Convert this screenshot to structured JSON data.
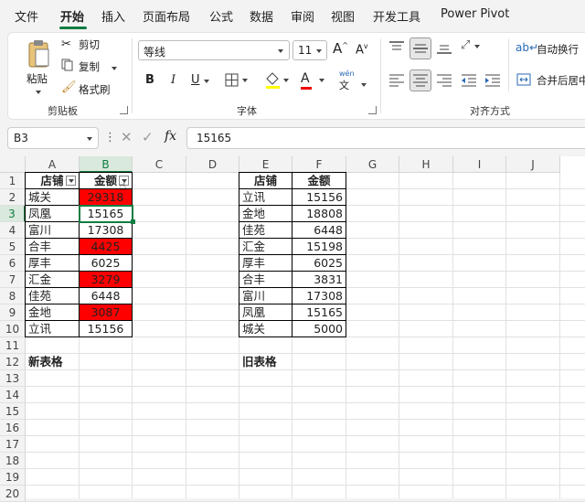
{
  "menu": [
    {
      "label": "文件",
      "active": false
    },
    {
      "label": "开始",
      "active": true
    },
    {
      "label": "插入",
      "active": false
    },
    {
      "label": "页面布局",
      "active": false
    },
    {
      "label": "公式",
      "active": false
    },
    {
      "label": "数据",
      "active": false
    },
    {
      "label": "审阅",
      "active": false
    },
    {
      "label": "视图",
      "active": false
    },
    {
      "label": "开发工具",
      "active": false
    },
    {
      "label": "Power Pivot",
      "active": false
    }
  ],
  "ribbon": {
    "clipboard": {
      "paste": "粘贴",
      "cut": "剪切",
      "copy": "复制",
      "format_painter": "格式刷",
      "group": "剪贴板"
    },
    "font": {
      "name": "等线",
      "size": "11",
      "group": "字体",
      "grow": "A",
      "shrink": "A",
      "bold": "B",
      "italic": "I",
      "underline": "U",
      "font_color": "A",
      "phonetic": "wén"
    },
    "alignment": {
      "wrap": "自动换行",
      "merge": "合并后居中",
      "group": "对齐方式"
    }
  },
  "formula_bar": {
    "name_box": "B3",
    "formula": "15165",
    "fx": "fx"
  },
  "columns": [
    "A",
    "B",
    "C",
    "D",
    "E",
    "F",
    "G",
    "H",
    "I",
    "J"
  ],
  "rows": [
    "1",
    "2",
    "3",
    "4",
    "5",
    "6",
    "7",
    "8",
    "9",
    "10",
    "11",
    "12",
    "13",
    "14",
    "15",
    "16",
    "17",
    "18",
    "19",
    "20"
  ],
  "new_table": {
    "headers": [
      "店铺",
      "金额"
    ],
    "rows": [
      {
        "shop": "城关",
        "amount": "29318",
        "highlight": true
      },
      {
        "shop": "凤凰",
        "amount": "15165",
        "highlight": false
      },
      {
        "shop": "富川",
        "amount": "17308",
        "highlight": false
      },
      {
        "shop": "合丰",
        "amount": "4425",
        "highlight": true
      },
      {
        "shop": "厚丰",
        "amount": "6025",
        "highlight": false
      },
      {
        "shop": "汇金",
        "amount": "3279",
        "highlight": true
      },
      {
        "shop": "佳苑",
        "amount": "6448",
        "highlight": false
      },
      {
        "shop": "金地",
        "amount": "3087",
        "highlight": true
      },
      {
        "shop": "立讯",
        "amount": "15156",
        "highlight": false
      }
    ],
    "caption": "新表格"
  },
  "old_table": {
    "headers": [
      "店铺",
      "金额"
    ],
    "rows": [
      {
        "shop": "立讯",
        "amount": "15156"
      },
      {
        "shop": "金地",
        "amount": "18808"
      },
      {
        "shop": "佳苑",
        "amount": "6448"
      },
      {
        "shop": "汇金",
        "amount": "15198"
      },
      {
        "shop": "厚丰",
        "amount": "6025"
      },
      {
        "shop": "合丰",
        "amount": "3831"
      },
      {
        "shop": "富川",
        "amount": "17308"
      },
      {
        "shop": "凤凰",
        "amount": "15165"
      },
      {
        "shop": "城关",
        "amount": "5000"
      }
    ],
    "caption": "旧表格"
  },
  "colors": {
    "accent": "#107c41",
    "highlight": "#ff0000"
  }
}
